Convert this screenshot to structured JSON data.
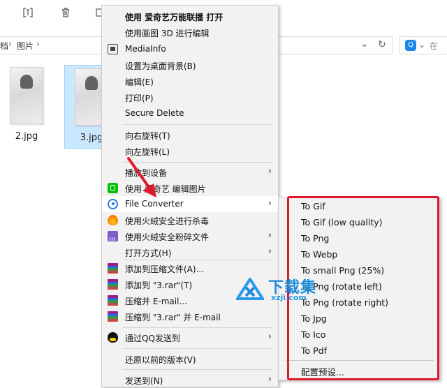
{
  "toolbar": {
    "icons": [
      "rename-icon",
      "delete-icon",
      "more-icon"
    ]
  },
  "address": {
    "crumbs": [
      "档",
      "图片"
    ],
    "separator": "›",
    "dropdown_glyph": "⌄",
    "refresh_glyph": "↻",
    "search_placeholder": "在"
  },
  "files": [
    {
      "name": "2.jpg",
      "selected": false
    },
    {
      "name": "3.jpg",
      "selected": true
    }
  ],
  "context_menu": {
    "items": [
      {
        "label": "使用 爱奇艺万能联播 打开",
        "icon": null,
        "bold": true,
        "arrow": false
      },
      {
        "label": "使用画图 3D 进行编辑",
        "icon": null,
        "bold": false,
        "arrow": false
      },
      {
        "label": "MediaInfo",
        "icon": "media-icon",
        "bold": false,
        "arrow": false
      },
      {
        "label": "设置为桌面背景(B)",
        "icon": null,
        "bold": false,
        "arrow": false
      },
      {
        "label": "编辑(E)",
        "icon": null,
        "bold": false,
        "arrow": false
      },
      {
        "label": "打印(P)",
        "icon": null,
        "bold": false,
        "arrow": false
      },
      {
        "label": "Secure Delete",
        "icon": null,
        "bold": false,
        "arrow": false
      },
      {
        "label": "向右旋转(T)",
        "icon": null,
        "bold": false,
        "arrow": false
      },
      {
        "label": "向左旋转(L)",
        "icon": null,
        "bold": false,
        "arrow": false
      },
      {
        "label": "播放到设备",
        "icon": null,
        "bold": false,
        "arrow": true
      },
      {
        "label": "使用 爱奇艺 编辑图片",
        "icon": "iqiyi-icon",
        "bold": false,
        "arrow": false
      },
      {
        "label": "File Converter",
        "icon": "file-converter-icon",
        "bold": false,
        "arrow": true,
        "hover": true
      },
      {
        "label": "使用火绒安全进行杀毒",
        "icon": "huorong-icon",
        "bold": false,
        "arrow": false
      },
      {
        "label": "使用火绒安全粉碎文件",
        "icon": "shredder-icon",
        "bold": false,
        "arrow": true
      },
      {
        "label": "打开方式(H)",
        "icon": null,
        "bold": false,
        "arrow": true
      },
      {
        "label": "添加到压缩文件(A)...",
        "icon": "winrar-icon",
        "bold": false,
        "arrow": false
      },
      {
        "label": "添加到 \"3.rar\"(T)",
        "icon": "winrar-icon",
        "bold": false,
        "arrow": false
      },
      {
        "label": "压缩并 E-mail...",
        "icon": "winrar-icon",
        "bold": false,
        "arrow": false
      },
      {
        "label": "压缩到 \"3.rar\" 并 E-mail",
        "icon": "winrar-icon",
        "bold": false,
        "arrow": false
      },
      {
        "label": "通过QQ发送到",
        "icon": "qq-icon",
        "bold": false,
        "arrow": true
      },
      {
        "label": "还原以前的版本(V)",
        "icon": null,
        "bold": false,
        "arrow": false
      },
      {
        "label": "发送到(N)",
        "icon": null,
        "bold": false,
        "arrow": true
      }
    ],
    "arrow_glyph": "›"
  },
  "submenu": {
    "items": [
      "To Gif",
      "To Gif (low quality)",
      "To Png",
      "To Webp",
      "To small Png (25%)",
      "To Png (rotate left)",
      "To Png (rotate right)",
      "To Jpg",
      "To Ico",
      "To Pdf"
    ],
    "footer": "配置预设..."
  },
  "watermark": {
    "title": "下载集",
    "domain": "xzji.com"
  },
  "colors": {
    "highlight_box": "#e0192f",
    "arrow": "#e0192f",
    "selection": "#cce8ff"
  }
}
